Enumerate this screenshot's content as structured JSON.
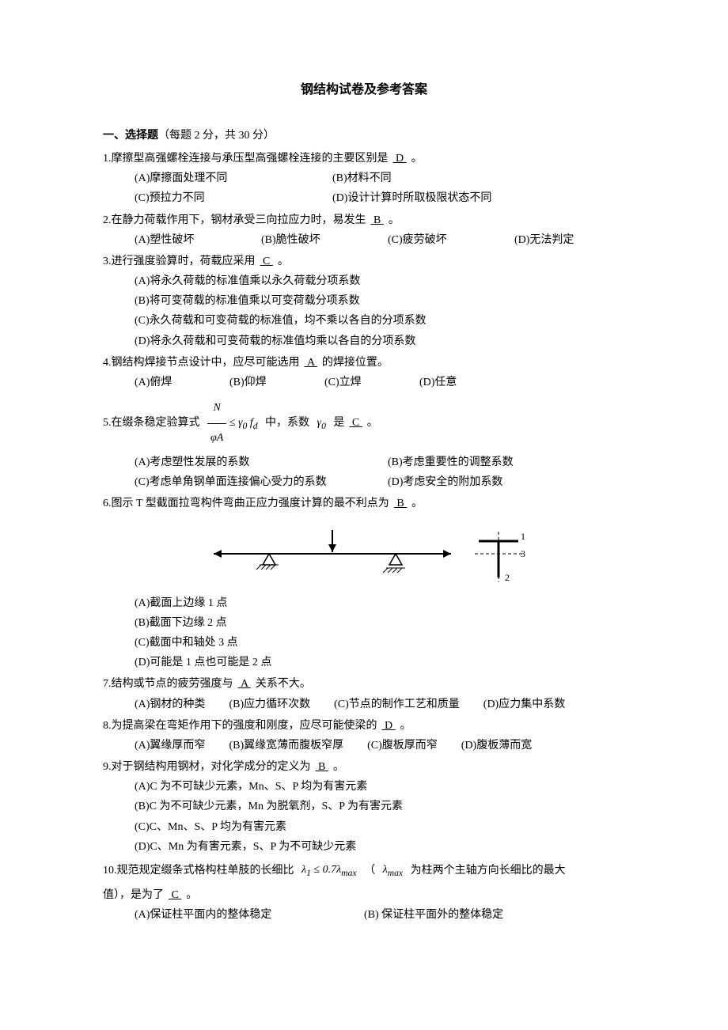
{
  "title": "钢结构试卷及参考答案",
  "section1": {
    "heading_bold": "一、选择题",
    "heading_rest": "（每题 2 分，共 30 分）"
  },
  "q1": {
    "stem_a": "1.摩擦型高强螺栓连接与承压型高强螺栓连接的主要区别是",
    "ans": "  D  ",
    "stem_b": "。",
    "a": "(A)摩擦面处理不同",
    "b": "(B)材料不同",
    "c": "(C)预拉力不同",
    "d": "(D)设计计算时所取极限状态不同"
  },
  "q2": {
    "stem_a": "2.在静力荷载作用下，钢材承受三向拉应力时，易发生",
    "ans": "  B  ",
    "stem_b": "。",
    "a": "(A)塑性破坏",
    "b": "(B)脆性破坏",
    "c": "(C)疲劳破坏",
    "d": "(D)无法判定"
  },
  "q3": {
    "stem_a": "3.进行强度验算时，荷载应采用",
    "ans": "  C  ",
    "stem_b": "。",
    "a": "(A)将永久荷载的标准值乘以永久荷载分项系数",
    "b": "(B)将可变荷载的标准值乘以可变荷载分项系数",
    "c": "(C)永久荷载和可变荷载的标准值，均不乘以各自的分项系数",
    "d": "(D)将永久荷载和可变荷载的标准值均乘以各自的分项系数"
  },
  "q4": {
    "stem_a": "4.钢结构焊接节点设计中，应尽可能选用",
    "ans": "  A  ",
    "stem_b": "的焊接位置。",
    "a": "(A)俯焊",
    "b": "(B)仰焊",
    "c": "(C)立焊",
    "d": "(D)任意"
  },
  "q5": {
    "stem_a": "5.在缀条稳定验算式",
    "formula_num": "N",
    "formula_den": "φA",
    "formula_rel": "≤ γ",
    "formula_sub0": "0",
    "formula_fd": " f",
    "formula_dsub": "d",
    "stem_mid": "中，系数",
    "gamma": "γ",
    "gamma_sub": "0",
    "stem_end": "是",
    "ans": "  C  ",
    "stem_b": "。",
    "a": "(A)考虑塑性发展的系数",
    "b": "(B)考虑重要性的调整系数",
    "c": "(C)考虑单角钢单面连接偏心受力的系数",
    "d": "(D)考虑安全的附加系数"
  },
  "q6": {
    "stem_a": "6.图示 T 型截面拉弯构件弯曲正应力强度计算的最不利点为",
    "ans": "  B  ",
    "stem_b": "。",
    "a": "(A)截面上边缘 1 点",
    "b": "(B)截面下边缘 2 点",
    "c": "(C)截面中和轴处 3 点",
    "d": "(D)可能是 1 点也可能是 2 点"
  },
  "q7": {
    "stem_a": "7.结构或节点的疲劳强度与",
    "ans": "  A  ",
    "stem_b": "关系不大。",
    "a": "(A)钢材的种类",
    "b": "(B)应力循环次数",
    "c": "(C)节点的制作工艺和质量",
    "d": "(D)应力集中系数"
  },
  "q8": {
    "stem_a": "8.为提高梁在弯矩作用下的强度和刚度，应尽可能使梁的",
    "ans": "  D  ",
    "stem_b": "。",
    "a": "(A)翼缘厚而窄",
    "b": "(B)翼缘宽薄而腹板窄厚",
    "c": "(C)腹板厚而窄",
    "d": "(D)腹板薄而宽"
  },
  "q9": {
    "stem_a": "9.对于钢结构用钢材，对化学成分的定义为",
    "ans": "   B  ",
    "stem_b": "。",
    "a": "(A)C 为不可缺少元素，Mn、S、P 均为有害元素",
    "b": "(B)C 为不可缺少元素，Mn 为脱氧剂，S、P 为有害元素",
    "c": "(C)C、Mn、S、P 均为有害元素",
    "d": "(D)C、Mn 为有害元素，S、P 为不可缺少元素"
  },
  "q10": {
    "stem_a": "10.规范规定缀条式格构柱单肢的长细比",
    "lam1": "λ",
    "lam1sub": "1",
    "rel": " ≤ 0.7",
    "lammax": "λ",
    "lammaxsub": "max",
    "paren_open": "（",
    "lammax2": "λ",
    "lammax2sub": "max",
    "stem_mid": " 为柱两个主轴方向长细比的最大",
    "stem_line2": "值），是为了",
    "ans": "  C     ",
    "stem_b": "。",
    "a": "(A)保证柱平面内的整体稳定",
    "b": "(B) 保证柱平面外的整体稳定"
  }
}
